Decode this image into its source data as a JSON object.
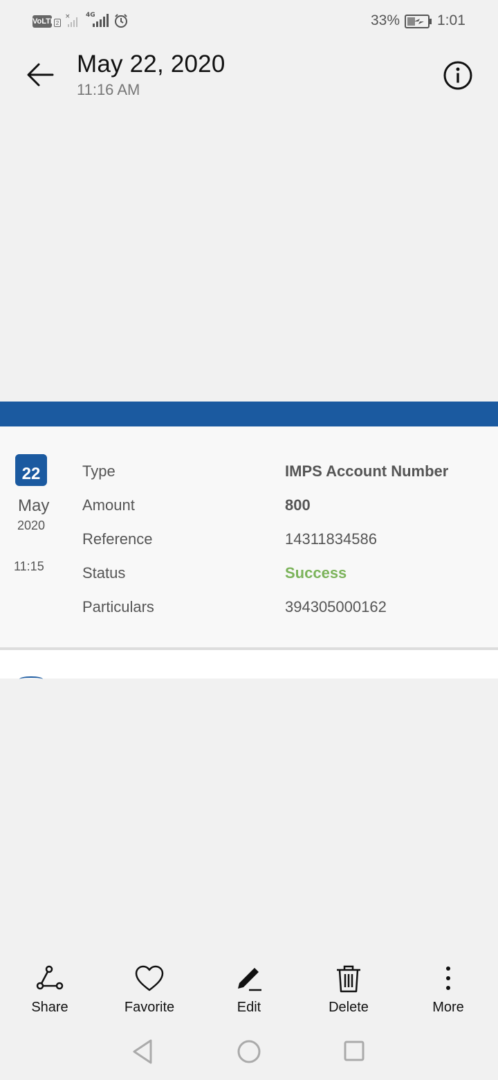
{
  "status_bar": {
    "volte_label": "VoLTE",
    "sim_label": "2",
    "network_label": "4G",
    "battery_percent": "33%",
    "clock": "1:01",
    "icons": [
      "volte-icon",
      "signal-off-icon",
      "signal-4g-icon",
      "alarm-icon",
      "battery-charging-icon"
    ]
  },
  "header": {
    "title": "May 22, 2020",
    "subtitle": "11:16 AM",
    "back_icon": "arrow-left-icon",
    "info_icon": "info-icon"
  },
  "image": {
    "date_badge": {
      "day": "22",
      "month": "May",
      "year": "2020",
      "time": "11:15"
    },
    "rows": [
      {
        "label": "Type",
        "value": "IMPS Account Number"
      },
      {
        "label": "Amount",
        "value": "800"
      },
      {
        "label": "Reference",
        "value": "14311834586"
      },
      {
        "label": "Status",
        "value": "Success"
      },
      {
        "label": "Particulars",
        "value": "394305000162"
      }
    ],
    "accent_color": "#1b5aa0",
    "success_color": "#7bb35a"
  },
  "actions": [
    {
      "label": "Share",
      "icon": "share-icon"
    },
    {
      "label": "Favorite",
      "icon": "heart-icon"
    },
    {
      "label": "Edit",
      "icon": "pencil-icon"
    },
    {
      "label": "Delete",
      "icon": "trash-icon"
    },
    {
      "label": "More",
      "icon": "more-vertical-icon"
    }
  ],
  "nav": [
    "back-triangle-icon",
    "home-circle-icon",
    "recents-square-icon"
  ]
}
